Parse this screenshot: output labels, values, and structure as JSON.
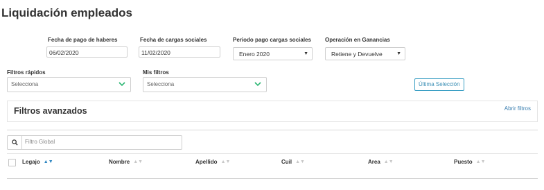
{
  "page": {
    "title": "Liquidación empleados"
  },
  "filters_top": {
    "fecha_pago": {
      "label": "Fecha de pago de haberes",
      "value": "06/02/2020"
    },
    "fecha_cargas": {
      "label": "Fecha de cargas sociales",
      "value": "11/02/2020"
    },
    "periodo": {
      "label": "Periodo pago cargas sociales",
      "value": "Enero 2020"
    },
    "operacion": {
      "label": "Operación en Ganancias",
      "value": "Retiene y Devuelve"
    }
  },
  "quick_filters": {
    "rapidos": {
      "label": "Filtros rápidos",
      "placeholder": "Selecciona"
    },
    "mis": {
      "label": "Mis filtros",
      "placeholder": "Selecciona"
    },
    "ultima_button": "Última Selección"
  },
  "advanced": {
    "title": "Filtros avanzados",
    "open_link": "Abrir filtros"
  },
  "table": {
    "search_placeholder": "Filtro Global",
    "columns": [
      "Legajo",
      "Nombre",
      "Apellido",
      "Cuil",
      "Area",
      "Puesto"
    ],
    "sorted_column": "Legajo"
  },
  "colors": {
    "accent": "#2e86c1",
    "chevron": "#2bb673"
  },
  "icons": {
    "search": "search-icon",
    "chevron": "chevron-down-icon",
    "sort": "sort-icon"
  }
}
